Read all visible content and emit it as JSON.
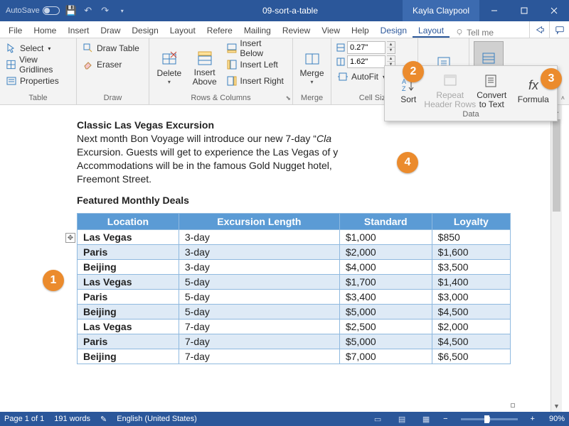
{
  "titlebar": {
    "autosave": "AutoSave",
    "doc_title": "09-sort-a-table",
    "user": "Kayla Claypool"
  },
  "tabs": [
    "File",
    "Home",
    "Insert",
    "Draw",
    "Design",
    "Layout",
    "Refere",
    "Mailing",
    "Review",
    "View",
    "Help"
  ],
  "ctx_tabs": {
    "design": "Design",
    "layout": "Layout"
  },
  "tellme": "Tell me",
  "ribbon": {
    "table": {
      "select": "Select",
      "gridlines": "View Gridlines",
      "properties": "Properties",
      "label": "Table"
    },
    "draw": {
      "draw": "Draw Table",
      "eraser": "Eraser",
      "label": "Draw"
    },
    "rows_cols": {
      "delete": "Delete",
      "above": "Insert\nAbove",
      "below": "Insert Below",
      "left": "Insert Left",
      "right": "Insert Right",
      "label": "Rows & Columns"
    },
    "merge": {
      "btn": "Merge",
      "label": "Merge"
    },
    "cell_size": {
      "height": "0.27\"",
      "width": "1.62\"",
      "autofit": "AutoFit",
      "label": "Cell Size"
    },
    "alignment": {
      "btn": "Alignment",
      "label": ""
    },
    "data": {
      "btn": "Data",
      "label": ""
    }
  },
  "data_popup": {
    "sort": "Sort",
    "repeat": "Repeat\nHeader Rows",
    "convert": "Convert\nto Text",
    "formula": "Formula",
    "label": "Data"
  },
  "doc": {
    "h1": "Classic Las Vegas Excursion",
    "p1a": "Next month Bon Voyage will introduce our new 7-day “",
    "p1i": "Cla",
    "p2": "Excursion. Guests will get to experience the Las Vegas of y",
    "p3": "Accommodations will be in the famous Gold Nugget hotel,",
    "p4": "Freemont Street.",
    "h2": "Featured Monthly Deals",
    "headers": [
      "Location",
      "Excursion Length",
      "Standard",
      "Loyalty"
    ],
    "rows": [
      [
        "Las Vegas",
        "3-day",
        "$1,000",
        "$850"
      ],
      [
        "Paris",
        "3-day",
        "$2,000",
        "$1,600"
      ],
      [
        "Beijing",
        "3-day",
        "$4,000",
        "$3,500"
      ],
      [
        "Las Vegas",
        "5-day",
        "$1,700",
        "$1,400"
      ],
      [
        "Paris",
        "5-day",
        "$3,400",
        "$3,000"
      ],
      [
        "Beijing",
        "5-day",
        "$5,000",
        "$4,500"
      ],
      [
        "Las Vegas",
        "7-day",
        "$2,500",
        "$2,000"
      ],
      [
        "Paris",
        "7-day",
        "$5,000",
        "$4,500"
      ],
      [
        "Beijing",
        "7-day",
        "$7,000",
        "$6,500"
      ]
    ]
  },
  "status": {
    "page": "Page 1 of 1",
    "words": "191 words",
    "lang": "English (United States)",
    "zoom": "90%"
  },
  "callouts": {
    "1": "1",
    "2": "2",
    "3": "3",
    "4": "4"
  }
}
